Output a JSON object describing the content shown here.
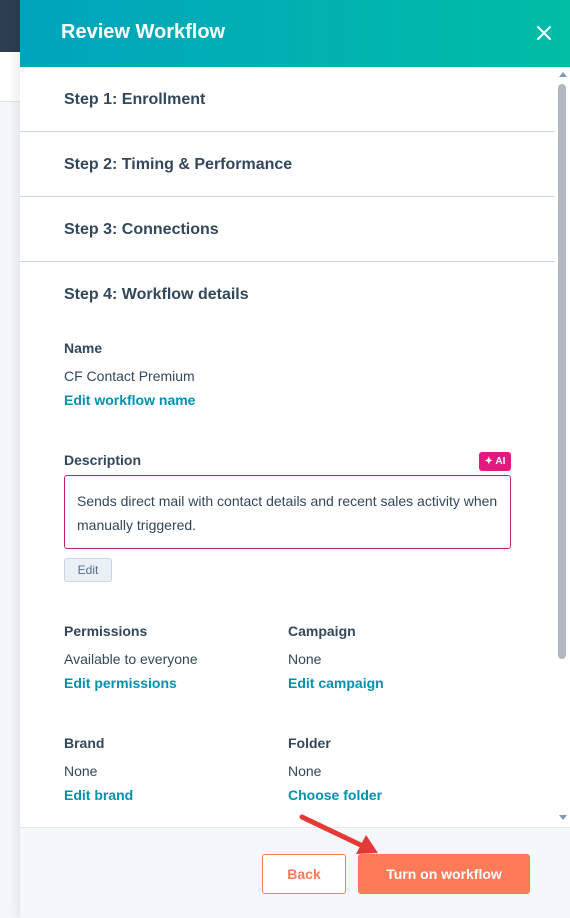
{
  "header": {
    "title": "Review Workflow",
    "close_icon": "close-icon"
  },
  "steps": [
    {
      "label": "Step 1: Enrollment"
    },
    {
      "label": "Step 2: Timing & Performance"
    },
    {
      "label": "Step 3: Connections"
    },
    {
      "label": "Step 4: Workflow details"
    }
  ],
  "details": {
    "name": {
      "label": "Name",
      "value": "CF Contact Premium",
      "link": "Edit workflow name"
    },
    "description": {
      "label": "Description",
      "ai_badge": "✦ AI",
      "text": "Sends direct mail with contact details and recent sales activity when manually triggered.",
      "edit_button": "Edit"
    },
    "permissions": {
      "label": "Permissions",
      "value": "Available to everyone",
      "link": "Edit permissions"
    },
    "campaign": {
      "label": "Campaign",
      "value": "None",
      "link": "Edit campaign"
    },
    "brand": {
      "label": "Brand",
      "value": "None",
      "link": "Edit brand"
    },
    "folder": {
      "label": "Folder",
      "value": "None",
      "link": "Choose folder"
    }
  },
  "footer": {
    "back_label": "Back",
    "primary_label": "Turn on workflow"
  },
  "colors": {
    "header_start": "#00a4bd",
    "header_end": "#00bda5",
    "accent": "#ff7a59",
    "link": "#0091ae",
    "ai": "#e5187f",
    "annotation_arrow": "#e53935"
  }
}
